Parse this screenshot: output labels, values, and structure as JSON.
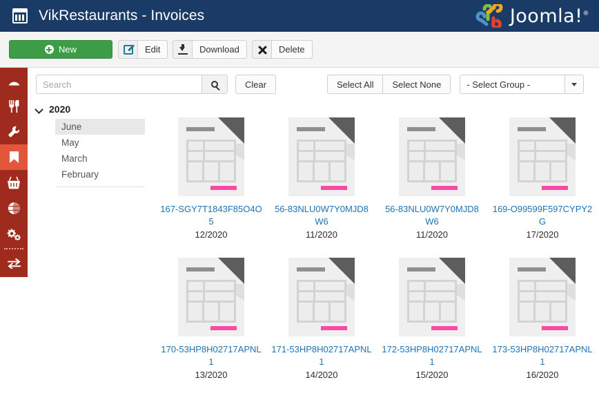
{
  "header": {
    "title": "VikRestaurants - Invoices",
    "calendar_icon": "calendar-icon",
    "brand": "Joomla!",
    "brand_reg": "®",
    "bar_color": "#1a3b66"
  },
  "toolbar": {
    "new_label": "New",
    "new_color": "#3d9c46",
    "edit_label": "Edit",
    "download_label": "Download",
    "delete_label": "Delete",
    "edit_icon": "pencil-square-icon",
    "download_icon": "download-arrow-icon",
    "delete_icon": "x-mark-icon"
  },
  "rail": {
    "background": "#9e2b1e",
    "active_color": "#e2563c",
    "items": [
      {
        "icon": "dashboard-gauge-icon",
        "active": false
      },
      {
        "icon": "fork-knife-icon",
        "active": false
      },
      {
        "icon": "wrench-icon",
        "active": false
      },
      {
        "icon": "bookmark-icon",
        "active": true
      },
      {
        "icon": "shopping-basket-icon",
        "active": false
      },
      {
        "icon": "globe-icon",
        "active": false
      },
      {
        "icon": "gears-icon",
        "active": false
      },
      {
        "icon": "exchange-arrows-icon",
        "active": false
      }
    ]
  },
  "filters": {
    "search_placeholder": "Search",
    "search_value": "",
    "search_icon": "magnifier-icon",
    "clear_label": "Clear",
    "select_all_label": "Select All",
    "select_none_label": "Select None",
    "group_selected": "- Select Group -",
    "group_caret_icon": "caret-down-icon"
  },
  "tree": {
    "year": "2020",
    "year_chevron_icon": "chevron-down-icon",
    "months": [
      {
        "label": "June",
        "selected": true
      },
      {
        "label": "May",
        "selected": false
      },
      {
        "label": "March",
        "selected": false
      },
      {
        "label": "February",
        "selected": false
      }
    ]
  },
  "files": [
    {
      "name": "167-SGY7T1843F85O4O5",
      "date": "12/2020",
      "icon": "invoice-document-icon"
    },
    {
      "name": "56-83NLU0W7Y0MJD8W6",
      "date": "11/2020",
      "icon": "invoice-document-icon"
    },
    {
      "name": "56-83NLU0W7Y0MJD8W6",
      "date": "11/2020",
      "icon": "invoice-document-icon"
    },
    {
      "name": "169-O99599F597CYPY2G",
      "date": "17/2020",
      "icon": "invoice-document-icon"
    },
    {
      "name": "170-53HP8H02717APNL1",
      "date": "13/2020",
      "icon": "invoice-document-icon"
    },
    {
      "name": "171-53HP8H02717APNL1",
      "date": "14/2020",
      "icon": "invoice-document-icon"
    },
    {
      "name": "172-53HP8H02717APNL1",
      "date": "15/2020",
      "icon": "invoice-document-icon"
    },
    {
      "name": "173-53HP8H02717APNL1",
      "date": "16/2020",
      "icon": "invoice-document-icon"
    }
  ],
  "colors": {
    "link": "#1f72b5",
    "doc_accent_pink": "#f94ba5",
    "doc_page": "#efefef",
    "doc_fold": "#5d5d5d"
  }
}
